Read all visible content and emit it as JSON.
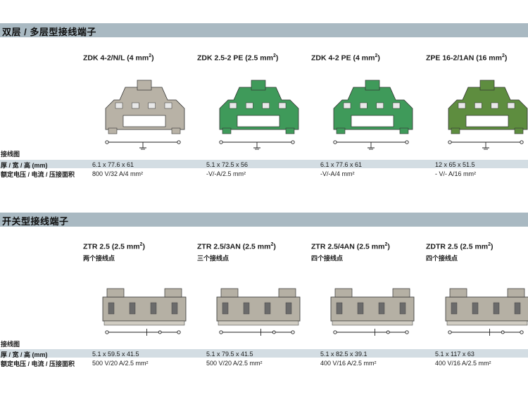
{
  "section1": {
    "title": "双层 / 多层型接线端子",
    "labels": {
      "wiring": "接线图",
      "dims": "厚 / 宽 / 高 (mm)",
      "rating": "额定电压 / 电流 / 压接面积"
    },
    "products": [
      {
        "name": "ZDK 4-2/N/L",
        "size": "(4 mm",
        "sup": "2",
        "close": ")",
        "dims": "6.1 x 77.6 x 61",
        "rating": "800 V/32 A/4 mm²",
        "color": "#b8b2a6"
      },
      {
        "name": "ZDK 2.5-2 PE",
        "size": "(2.5 mm",
        "sup": "2",
        "close": ")",
        "dims": "5.1 x 72.5 x 56",
        "rating": "-V/-A/2.5 mm²",
        "color": "#3f9a5a"
      },
      {
        "name": "ZDK 4-2 PE",
        "size": "(4 mm",
        "sup": "2",
        "close": ")",
        "dims": "6.1 x 77.6 x 61",
        "rating": "-V/-A/4 mm²",
        "color": "#3f9a5a"
      },
      {
        "name": "ZPE 16-2/1AN",
        "size": "(16 mm",
        "sup": "2",
        "close": ")",
        "dims": "12 x 65 x 51.5",
        "rating": "- V/- A/16 mm²",
        "color": "#5e8d3f"
      }
    ]
  },
  "section2": {
    "title": "开关型接线端子",
    "labels": {
      "wiring": "接线图",
      "dims": "厚 / 宽 / 高 (mm)",
      "rating": "额定电压 / 电流 / 压接面积"
    },
    "products": [
      {
        "name": "ZTR 2.5",
        "size": "(2.5 mm",
        "sup": "2",
        "close": ")",
        "sub": "两个接线点",
        "dims": "5.1 x 59.5 x 41.5",
        "rating": "500 V/20 A/2.5 mm²",
        "color": "#b5b0a4"
      },
      {
        "name": "ZTR 2.5/3AN",
        "size": "(2.5 mm",
        "sup": "2",
        "close": ")",
        "sub": "三个接线点",
        "dims": "5.1 x 79.5 x 41.5",
        "rating": "500 V/20 A/2.5 mm²",
        "color": "#b5b0a4"
      },
      {
        "name": "ZTR 2.5/4AN",
        "size": "(2.5 mm",
        "sup": "2",
        "close": ")",
        "sub": "四个接线点",
        "dims": "5.1 x 82.5 x 39.1",
        "rating": "400 V/16 A/2.5 mm²",
        "color": "#b5b0a4"
      },
      {
        "name": "ZDTR 2.5",
        "size": "(2.5 mm",
        "sup": "2",
        "close": ")",
        "sub": "四个接线点",
        "dims": "5.1 x 117 x 63",
        "rating": "400 V/16 A/2.5 mm²",
        "color": "#b5b0a4"
      }
    ]
  }
}
